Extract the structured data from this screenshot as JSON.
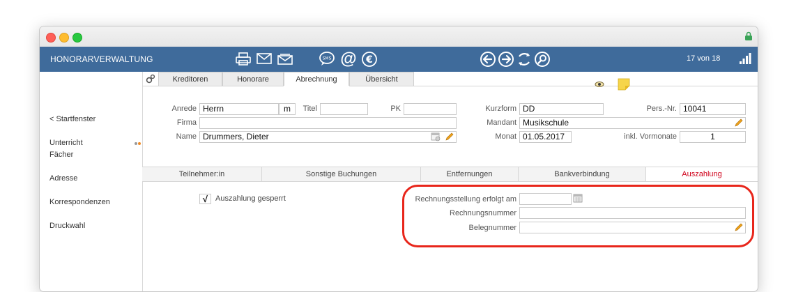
{
  "toolbar": {
    "title": "HONORARVERWALTUNG",
    "record_counter": "17 von 18"
  },
  "sidebar": {
    "items": [
      {
        "label": "< Startfenster"
      },
      {
        "label": "Unterricht"
      },
      {
        "label": "Fächer"
      },
      {
        "label": "Adresse"
      },
      {
        "label": "Korrespondenzen"
      },
      {
        "label": "Druckwahl"
      }
    ]
  },
  "tabs": [
    {
      "label": "Kreditoren"
    },
    {
      "label": "Honorare"
    },
    {
      "label": "Abrechnung",
      "active": true
    },
    {
      "label": "Übersicht"
    }
  ],
  "form": {
    "anrede_label": "Anrede",
    "anrede_value": "Herrn",
    "gender_value": "m",
    "titel_label": "Titel",
    "titel_value": "",
    "pk_label": "PK",
    "pk_value": "",
    "firma_label": "Firma",
    "firma_value": "",
    "name_label": "Name",
    "name_value": "Drummers, Dieter",
    "kurzform_label": "Kurzform",
    "kurzform_value": "DD",
    "persnr_label": "Pers.-Nr.",
    "persnr_value": "10041",
    "mandant_label": "Mandant",
    "mandant_value": "Musikschule",
    "monat_label": "Monat",
    "monat_value": "01.05.2017",
    "vormonate_label": "inkl. Vormonate",
    "vormonate_value": "1"
  },
  "subtabs": [
    {
      "label": "Teilnehmer:in"
    },
    {
      "label": "Sonstige Buchungen"
    },
    {
      "label": "Entfernungen"
    },
    {
      "label": "Bankverbindung"
    },
    {
      "label": "Auszahlung",
      "active": true
    }
  ],
  "auszahlung": {
    "gesperrt_label": "Auszahlung gesperrt",
    "gesperrt_checked": "√",
    "rechnungsstellung_label": "Rechnungsstellung erfolgt am",
    "rechnungsstellung_value": "",
    "rechnungsnummer_label": "Rechnungsnummer",
    "rechnungsnummer_value": "",
    "belegnummer_label": "Belegnummer",
    "belegnummer_value": ""
  },
  "colors": {
    "toolbar_bg": "#3f6b9b",
    "active_subtab": "#d0021b",
    "highlight_ring": "#e8261b",
    "pencil": "#f0a31c"
  }
}
